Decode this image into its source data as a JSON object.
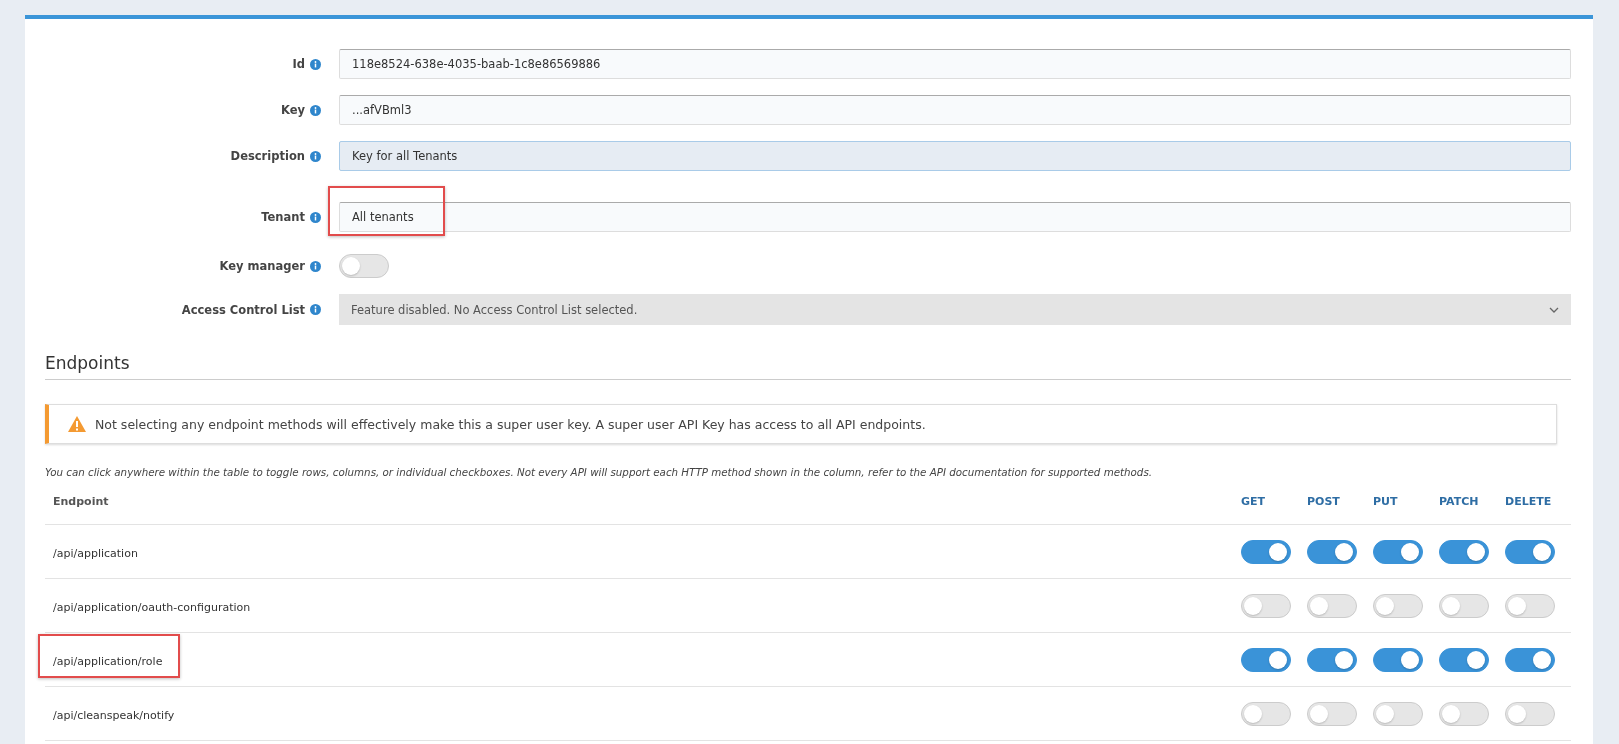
{
  "form": {
    "fields": [
      {
        "kind": "text",
        "label": "Id",
        "value": "118e8524-638e-4035-baab-1c8e86569886",
        "focused": false,
        "highlighted": false
      },
      {
        "kind": "text",
        "label": "Key",
        "value": "...afVBml3",
        "focused": false,
        "highlighted": false
      },
      {
        "kind": "text",
        "label": "Description",
        "value": "Key for all Tenants",
        "focused": true,
        "highlighted": false
      },
      {
        "kind": "text",
        "label": "Tenant",
        "value": "All tenants",
        "focused": false,
        "highlighted": true
      },
      {
        "kind": "toggle",
        "label": "Key manager",
        "on": false
      },
      {
        "kind": "select",
        "label": "Access Control List",
        "value": "Feature disabled. No Access Control List selected.",
        "disabled": true
      }
    ]
  },
  "endpoints": {
    "heading": "Endpoints",
    "warning": "Not selecting any endpoint methods will effectively make this a super user key. A super user API Key has access to all API endpoints.",
    "note": "You can click anywhere within the table to toggle rows, columns, or individual checkboxes. Not every API will support each HTTP method shown in the column, refer to the API documentation for supported methods.",
    "columns": [
      "Endpoint",
      "GET",
      "POST",
      "PUT",
      "PATCH",
      "DELETE"
    ],
    "rows": [
      {
        "path": "/api/application",
        "highlighted": false,
        "methods": [
          true,
          true,
          true,
          true,
          true
        ]
      },
      {
        "path": "/api/application/oauth-configuration",
        "highlighted": false,
        "methods": [
          false,
          false,
          false,
          false,
          false
        ]
      },
      {
        "path": "/api/application/role",
        "highlighted": true,
        "methods": [
          true,
          true,
          true,
          true,
          true
        ]
      },
      {
        "path": "/api/cleanspeak/notify",
        "highlighted": false,
        "methods": [
          false,
          false,
          false,
          false,
          false
        ]
      }
    ]
  }
}
